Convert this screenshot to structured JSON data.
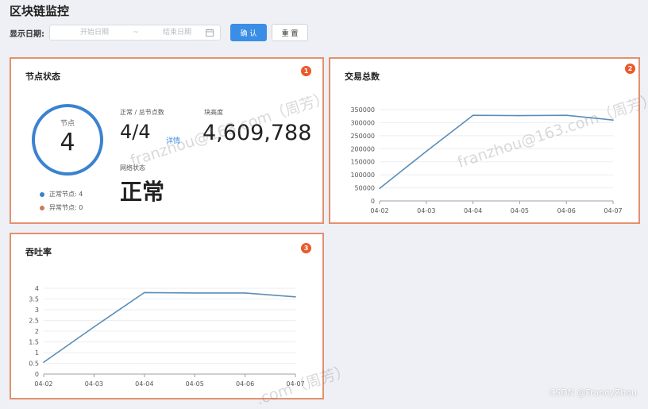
{
  "page": {
    "title": "区块链监控"
  },
  "filter": {
    "label": "显示日期:",
    "start_placeholder": "开始日期",
    "separator": "~",
    "end_placeholder": "结束日期",
    "confirm_label": "确 认",
    "reset_label": "重 置"
  },
  "node_card": {
    "title": "节点状态",
    "badge": "1",
    "ring_label": "节点",
    "ring_value": "4",
    "legend": [
      {
        "label": "正常节点: 4",
        "color": "#3b82cf"
      },
      {
        "label": "异常节点: 0",
        "color": "#c97b5b"
      }
    ],
    "ratio_label": "正常 / 总节点数",
    "ratio_value": "4/4",
    "detail_link": "详情",
    "block_height_label": "块高度",
    "block_height_value": "4,609,788",
    "network_label": "网络状态",
    "network_value": "正常"
  },
  "tx_card": {
    "title": "交易总数",
    "badge": "2"
  },
  "tps_card": {
    "title": "吞吐率",
    "badge": "3"
  },
  "chart_data": [
    {
      "type": "line",
      "title": "交易总数",
      "x": [
        "04-02",
        "04-03",
        "04-04",
        "04-05",
        "04-06",
        "04-07"
      ],
      "series": [
        {
          "values": [
            48000,
            190000,
            328000,
            327000,
            328000,
            310000
          ]
        }
      ],
      "yticks": [
        "0",
        "50000",
        "100000",
        "150000",
        "200000",
        "250000",
        "300000",
        "350000"
      ],
      "ylim": [
        0,
        350000
      ],
      "grid": true,
      "color": "#5b8db8"
    },
    {
      "type": "line",
      "title": "吞吐率",
      "x": [
        "04-02",
        "04-03",
        "04-04",
        "04-05",
        "04-06",
        "04-07"
      ],
      "series": [
        {
          "values": [
            0.55,
            2.2,
            3.8,
            3.78,
            3.78,
            3.6
          ]
        }
      ],
      "yticks": [
        "0",
        "0.5",
        "1",
        "1.5",
        "2",
        "2.5",
        "3",
        "3.5",
        "4"
      ],
      "ylim": [
        0,
        4
      ],
      "grid": true,
      "color": "#5b8db8"
    }
  ],
  "watermarks": [
    "franzhou@163.com（周芳）",
    "franzhou@163.com（周芳）",
    ".com（周芳）"
  ],
  "footer": {
    "credit": "CSDN @FrancyZhou"
  },
  "icons": {
    "calendar": "calendar-icon"
  }
}
